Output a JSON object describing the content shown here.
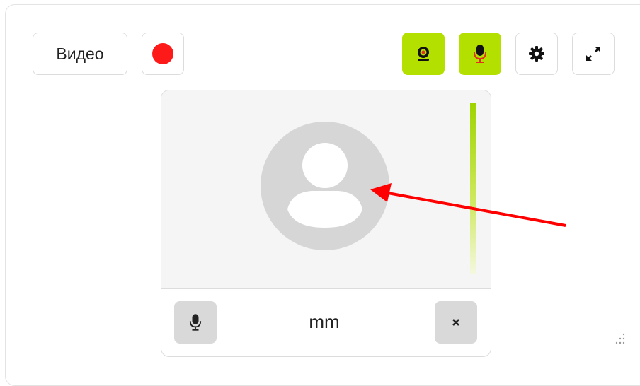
{
  "toolbar": {
    "video_label": "Видео",
    "record_icon": "record-icon",
    "camera_icon": "webcam-icon",
    "mic_icon": "microphone-icon",
    "settings_icon": "gear-icon",
    "fullscreen_icon": "expand-icon",
    "active_color": "#b4e000",
    "record_color": "#ff1a1a"
  },
  "participant": {
    "name": "mm",
    "avatar_icon": "user-avatar-icon",
    "mic_icon": "microphone-icon",
    "close_icon": "close-icon",
    "audio_level": 1.0
  },
  "annotation": {
    "arrow_color": "#ff0000"
  }
}
